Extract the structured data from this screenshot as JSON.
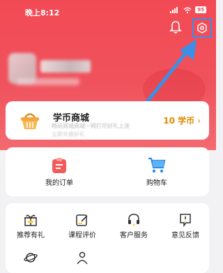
{
  "status_bar": {
    "time": "晚上8:12",
    "battery": "95"
  },
  "header": {
    "notification_icon": "bell-icon",
    "settings_icon": "gear-icon"
  },
  "mall": {
    "title": "学币商城",
    "subtitle_line1": "畅玩商城商城一网打尽好礼上涨",
    "subtitle_line2": "立即兑换好礼",
    "coins": "10 学币",
    "chevron": "›"
  },
  "orders": {
    "items": [
      {
        "label": "我的订单",
        "icon": "order-icon"
      },
      {
        "label": "购物车",
        "icon": "cart-icon"
      }
    ]
  },
  "services": {
    "items": [
      {
        "label": "推荐有礼",
        "icon": "gift-icon"
      },
      {
        "label": "课程评价",
        "icon": "edit-icon"
      },
      {
        "label": "客户服务",
        "icon": "headset-icon"
      },
      {
        "label": "意见反馈",
        "icon": "feedback-icon"
      }
    ]
  },
  "colors": {
    "brand": "#f24a55",
    "accent": "#e08a00",
    "highlight": "#3b8fe6"
  }
}
